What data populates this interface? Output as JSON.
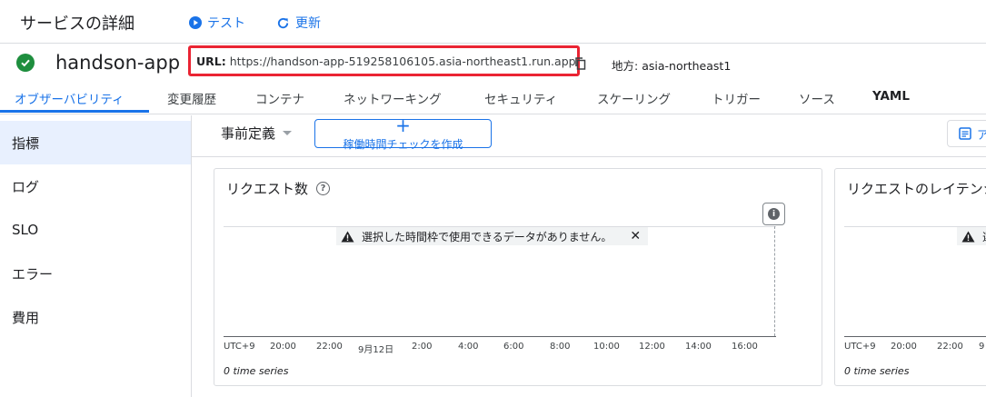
{
  "header": {
    "title": "サービスの詳細",
    "test_label": "テスト",
    "refresh_label": "更新"
  },
  "service": {
    "name": "handson-app",
    "url_label": "URL:",
    "url": "https://handson-app-519258106105.asia-northeast1.run.app",
    "region_label": "地方:",
    "region": "asia-northeast1"
  },
  "tabs": [
    {
      "label": "オブザーバビリティ"
    },
    {
      "label": "変更履歴"
    },
    {
      "label": "コンテナ"
    },
    {
      "label": "ネットワーキング"
    },
    {
      "label": "セキュリティ"
    },
    {
      "label": "スケーリング"
    },
    {
      "label": "トリガー"
    },
    {
      "label": "ソース"
    },
    {
      "label": "YAML"
    }
  ],
  "sidebar": {
    "items": [
      {
        "label": "指標"
      },
      {
        "label": "ログ"
      },
      {
        "label": "SLO"
      },
      {
        "label": "エラー"
      },
      {
        "label": "費用"
      }
    ]
  },
  "toolbar": {
    "preset_label": "事前定義",
    "uptime_label": "稼働時間チェックを作成",
    "right_button_label": "ア"
  },
  "cards": [
    {
      "title": "リクエスト数",
      "no_data": "選択した時間枠で使用できるデータがありません。",
      "series_count": "0 time series",
      "ticks": [
        "UTC+9",
        "20:00",
        "22:00",
        "9月12日",
        "2:00",
        "4:00",
        "6:00",
        "8:00",
        "10:00",
        "12:00",
        "14:00",
        "16:00"
      ]
    },
    {
      "title": "リクエストのレイテンシ",
      "no_data": "選",
      "series_count": "0 time series",
      "ticks": [
        "UTC+9",
        "20:00",
        "22:00",
        "9"
      ]
    }
  ],
  "colors": {
    "accent": "#1a73e8",
    "success": "#1e8e3e",
    "highlight_border": "#ea2433",
    "active_bg": "#e8f0fe"
  },
  "icons": {
    "test": "play-circle-icon",
    "refresh": "refresh-icon",
    "status": "check-circle-icon",
    "copy": "copy-icon",
    "help": "help-circle-icon",
    "warning": "warning-icon",
    "close": "close-icon",
    "info": "info-icon",
    "add": "plus-icon"
  }
}
